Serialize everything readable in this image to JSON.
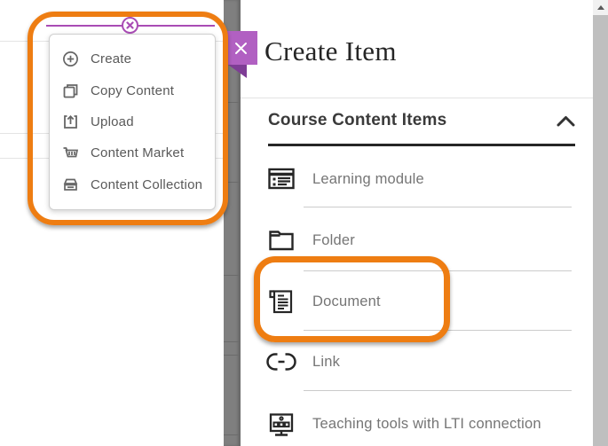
{
  "colors": {
    "annotation_orange": "#ee7d12",
    "insertion_purple": "#a94cb5",
    "close_button_purple": "#b160c2",
    "panel_text_dark": "#262626"
  },
  "insertion_indicator": {
    "icon": "circle-x-icon"
  },
  "context_menu": {
    "items": [
      {
        "label": "Create",
        "icon": "plus-circle-icon"
      },
      {
        "label": "Copy Content",
        "icon": "copy-icon"
      },
      {
        "label": "Upload",
        "icon": "upload-icon"
      },
      {
        "label": "Content Market",
        "icon": "content-market-icon"
      },
      {
        "label": "Content Collection",
        "icon": "content-collection-icon"
      }
    ]
  },
  "panel": {
    "title": "Create Item",
    "close_icon": "close-icon",
    "section": {
      "title": "Course Content Items",
      "collapse_icon": "chevron-up-icon",
      "state": "expanded"
    },
    "items": [
      {
        "label": "Learning module",
        "icon": "learning-module-icon"
      },
      {
        "label": "Folder",
        "icon": "folder-icon"
      },
      {
        "label": "Document",
        "icon": "document-icon",
        "highlighted": true
      },
      {
        "label": "Link",
        "icon": "link-icon"
      },
      {
        "label": "Teaching tools with LTI connection",
        "icon": "lti-connection-icon"
      }
    ]
  }
}
